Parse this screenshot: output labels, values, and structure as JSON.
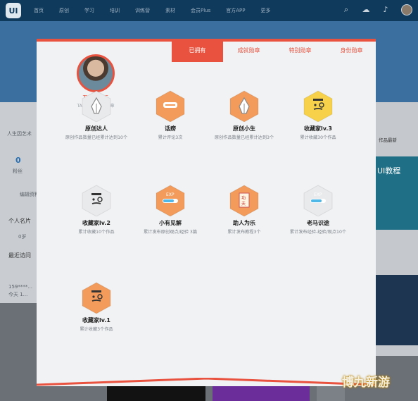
{
  "nav": {
    "logo": "UI",
    "items": [
      "首页",
      "原创",
      "学习",
      "培训",
      "训练营",
      "素材",
      "会员Plus",
      "官方APP",
      "更多"
    ]
  },
  "background": {
    "left_texts": [
      "人生因艺术",
      "0",
      "粉丝",
      "编辑资料",
      "个人名片",
      "0岁",
      "最近访问",
      "159****...",
      "今天 1..."
    ],
    "right_texts": [
      "作品最新",
      "UI教程"
    ]
  },
  "profile": {
    "name": "Tiffany_S",
    "subtitle": "TA已经获得0枚勋章"
  },
  "tabs": [
    {
      "label": "已拥有",
      "active": true
    },
    {
      "label": "成就勋章",
      "active": false
    },
    {
      "label": "特别勋章",
      "active": false
    },
    {
      "label": "身份勋章",
      "active": false
    }
  ],
  "badges": [
    {
      "name": "原创达人",
      "desc": "原创作品数量已经累计达到10个",
      "icon": "pen-nib-icon",
      "color": "#e9eaec"
    },
    {
      "name": "话痨",
      "desc": "累计评论3次",
      "icon": "chat-bubble-icon",
      "color": "#f29b5a"
    },
    {
      "name": "原创小生",
      "desc": "原创作品数量已经累计达到3个",
      "icon": "pen-nib-icon",
      "color": "#f29b5a"
    },
    {
      "name": "收藏家lv.3",
      "desc": "累计收藏30个作品",
      "icon": "monocle-face-icon",
      "color": "#f7d14a"
    },
    {
      "name": "收藏家lv.2",
      "desc": "累计收藏10个作品",
      "icon": "monocle-face-icon",
      "color": "#e9eaec"
    },
    {
      "name": "小有见解",
      "desc": "累计发布原创观点/经验 3篇",
      "icon": "exp-bar-icon",
      "color": "#f29b5a"
    },
    {
      "name": "助人为乐",
      "desc": "累计发布教程3个",
      "icon": "scroll-icon",
      "color": "#f29b5a"
    },
    {
      "name": "老马识途",
      "desc": "累计发布经验-经验/观点10个",
      "icon": "exp-bar-icon",
      "color": "#e9eaec"
    },
    {
      "name": "收藏家lv.1",
      "desc": "累计收藏3个作品",
      "icon": "monocle-face-icon",
      "color": "#f29b5a"
    }
  ],
  "watermark": "博九新游",
  "colors": {
    "accent": "#e8523e",
    "header": "#0f3a5c"
  }
}
